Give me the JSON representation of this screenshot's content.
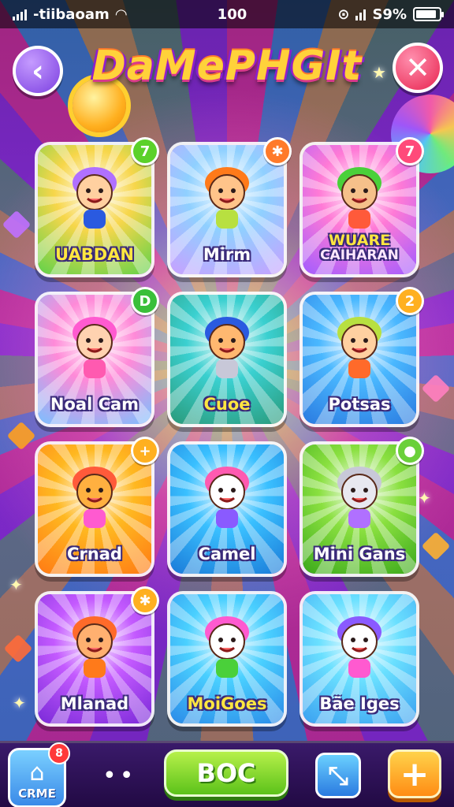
{
  "status_bar": {
    "carrier": "-tiibaoam",
    "time": "100",
    "battery": "S9%",
    "battery_level": 0.9
  },
  "header": {
    "title": "DaMePHGIt",
    "back_icon": "chevron-left-icon",
    "close_icon": "close-icon"
  },
  "tiles": [
    {
      "label": "UABDAN",
      "badge": "7",
      "badge_color": "#5bd12a",
      "bg": "#f7d64a",
      "bg2": "#5fd24a",
      "label_color": "yellow"
    },
    {
      "label": "Mirm",
      "badge": "✱",
      "badge_color": "#ff7a2a",
      "bg": "#8fd0ff",
      "bg2": "#c8a0ff",
      "label_color": "white"
    },
    {
      "label": "WUARE",
      "label2": "CAIHARAN",
      "badge": "7",
      "badge_color": "#ff4a7a",
      "bg": "#ff7ad6",
      "bg2": "#a25cff",
      "label_color": "yellow"
    },
    {
      "label": "Noal Cam",
      "badge": "D",
      "badge_color": "#3abf3a",
      "bg": "#ff8ad8",
      "bg2": "#7ac0ff",
      "label_color": "white"
    },
    {
      "label": "Cuoe",
      "badge": "",
      "badge_color": "",
      "bg": "#3ad0d0",
      "bg2": "#2a9a7a",
      "label_color": "yellow"
    },
    {
      "label": "Potsas",
      "badge": "2",
      "badge_color": "#ffb020",
      "bg": "#4ab8ff",
      "bg2": "#2a7ae0",
      "label_color": "white"
    },
    {
      "label": "Crnad",
      "badge": "+",
      "badge_color": "#ffb020",
      "bg": "#ffb820",
      "bg2": "#ff7a14",
      "label_color": "white"
    },
    {
      "label": "Camel",
      "badge": "",
      "badge_color": "",
      "bg": "#3ac0ff",
      "bg2": "#1a7ad8",
      "label_color": "white"
    },
    {
      "label": "Mini Gans",
      "badge": "●",
      "badge_color": "#6ad03a",
      "bg": "#8ae040",
      "bg2": "#3aa81a",
      "label_color": "white"
    },
    {
      "label": "Mlanad",
      "badge": "✱",
      "badge_color": "#ffb020",
      "bg": "#c45aff",
      "bg2": "#7a2ad8",
      "label_color": "white"
    },
    {
      "label": "MoiGoes",
      "badge": "",
      "badge_color": "",
      "bg": "#4ad0ff",
      "bg2": "#2a8ae8",
      "label_color": "yellow"
    },
    {
      "label": "Bãe Iges",
      "badge": "",
      "badge_color": "",
      "bg": "#6ae0ff",
      "bg2": "#3aa0f0",
      "label_color": "white"
    }
  ],
  "bottom_bar": {
    "home_label": "CRME",
    "home_badge": "8",
    "dots": "••",
    "boc_label": "BOC",
    "share_icon": "share-arrow-icon",
    "add_icon": "plus-icon"
  }
}
